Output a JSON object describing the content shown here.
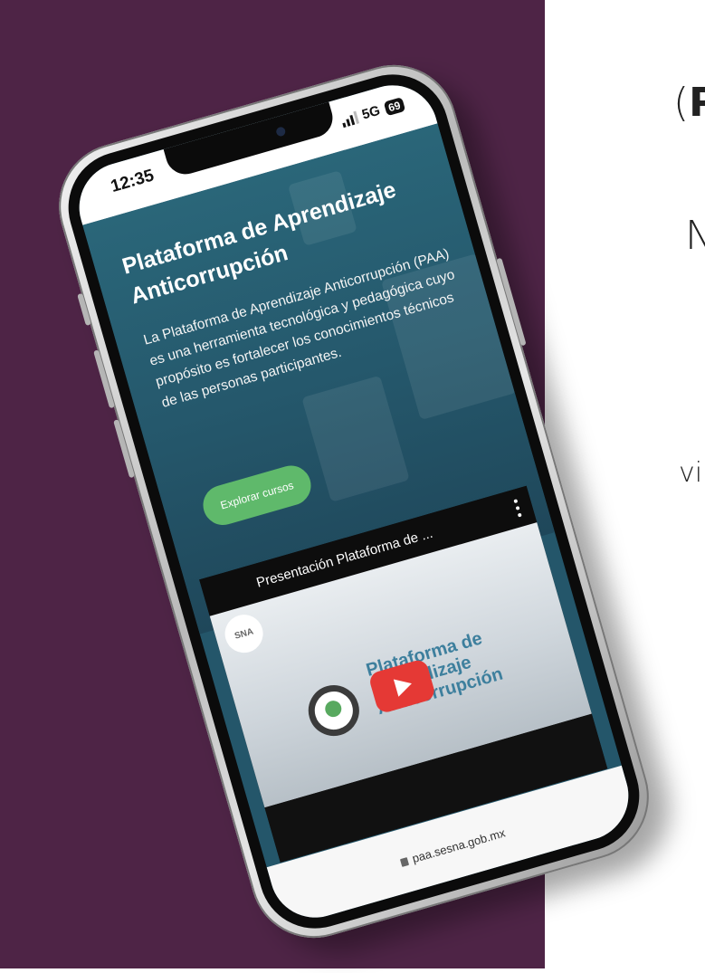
{
  "side_text": {
    "paren_open": "(",
    "paren_bold": "P",
    "line_2": "N",
    "line_3": "vi"
  },
  "status_bar": {
    "time": "12:35",
    "network": "5G",
    "battery": "69"
  },
  "hero": {
    "title": "Plataforma de Aprendizaje Anticorrupción",
    "description": "La Plataforma de Aprendizaje Anticorrupción (PAA) es una herramienta tecnológica y pedagógica cuyo propósito es fortalecer los conocimientos técnicos de las personas participantes.",
    "button_label": "Explorar cursos"
  },
  "video": {
    "title": "Presentación Plataforma de ...",
    "channel": "SNA",
    "brand_text": "Plataforma de\nAprendizaje\nAnticorrupción"
  },
  "browser": {
    "url": "paa.sesna.gob.mx"
  },
  "colors": {
    "background_purple": "#4e2446",
    "hero_teal": "#25586c",
    "button_green": "#5fb96b",
    "play_red": "#e53935"
  }
}
